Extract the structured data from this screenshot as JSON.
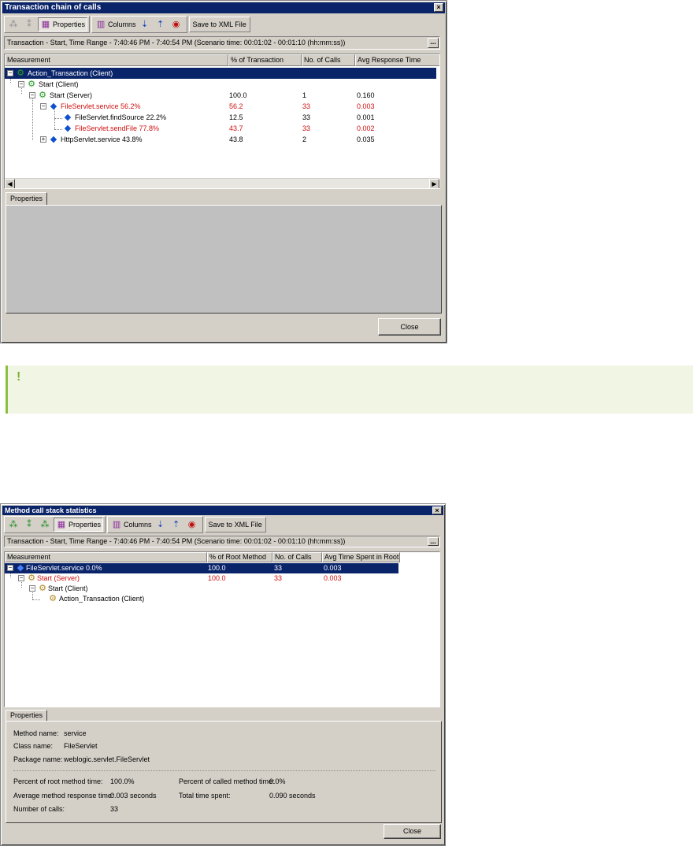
{
  "w1": {
    "title": "Transaction chain of calls",
    "toolbar": {
      "properties": "Properties",
      "columns": "Columns",
      "save_xml": "Save to XML File"
    },
    "range": "Transaction - Start, Time Range - 7:40:46 PM - 7:40:54 PM (Scenario time: 00:01:02 - 00:01:10 (hh:mm:ss))",
    "columns": [
      "Measurement",
      "% of Transaction",
      "No. of Calls",
      "Avg Response Time"
    ],
    "rows": [
      {
        "name": "Action_Transaction (Client)",
        "pct": "",
        "calls": "",
        "avg": ""
      },
      {
        "name": "Start (Client)",
        "pct": "",
        "calls": "",
        "avg": ""
      },
      {
        "name": "Start (Server)",
        "pct": "100.0",
        "calls": "1",
        "avg": "0.160"
      },
      {
        "name": "FileServlet.service   56.2%",
        "pct": "56.2",
        "calls": "33",
        "avg": "0.003"
      },
      {
        "name": "FileServlet.findSource   22.2%",
        "pct": "12.5",
        "calls": "33",
        "avg": "0.001"
      },
      {
        "name": "FileServlet.sendFile   77.8%",
        "pct": "43.7",
        "calls": "33",
        "avg": "0.002"
      },
      {
        "name": "HttpServlet.service   43.8%",
        "pct": "43.8",
        "calls": "2",
        "avg": "0.035"
      }
    ],
    "tab": "Properties",
    "close": "Close"
  },
  "tip": {
    "icon": "lightbulb-icon",
    "text": ""
  },
  "w2": {
    "title": "Method call stack statistics",
    "toolbar": {
      "properties": "Properties",
      "columns": "Columns",
      "save_xml": "Save to XML File"
    },
    "range": "Transaction - Start, Time Range - 7:40:46 PM - 7:40:54 PM (Scenario time: 00:01:02 - 00:01:10 (hh:mm:ss))",
    "columns": [
      "Measurement",
      "% of Root Method",
      "No. of Calls",
      "Avg Time Spent in Root"
    ],
    "rows": [
      {
        "name": "FileServlet.service  0.0%",
        "pct": "100.0",
        "calls": "33",
        "avg": "0.003"
      },
      {
        "name": "Start (Server)",
        "pct": "100.0",
        "calls": "33",
        "avg": "0.003"
      },
      {
        "name": "Start (Client)",
        "pct": "",
        "calls": "",
        "avg": ""
      },
      {
        "name": "Action_Transaction (Client)",
        "pct": "",
        "calls": "",
        "avg": ""
      }
    ],
    "tab": "Properties",
    "props": {
      "method_label": "Method name:",
      "method_value": "service",
      "class_label": "Class name:",
      "class_value": "FileServlet",
      "package_label": "Package name:",
      "package_value": "weblogic.servlet.FileServlet",
      "pct_root_label": "Percent of root method time:",
      "pct_root_value": "100.0%",
      "pct_called_label": "Percent of called method time:",
      "pct_called_value": "0.0%",
      "avg_resp_label": "Average method response time:",
      "avg_resp_value": "0.003 seconds",
      "total_label": "Total time spent:",
      "total_value": "0.090 seconds",
      "calls_label": "Number of calls:",
      "calls_value": "33"
    },
    "close": "Close"
  }
}
